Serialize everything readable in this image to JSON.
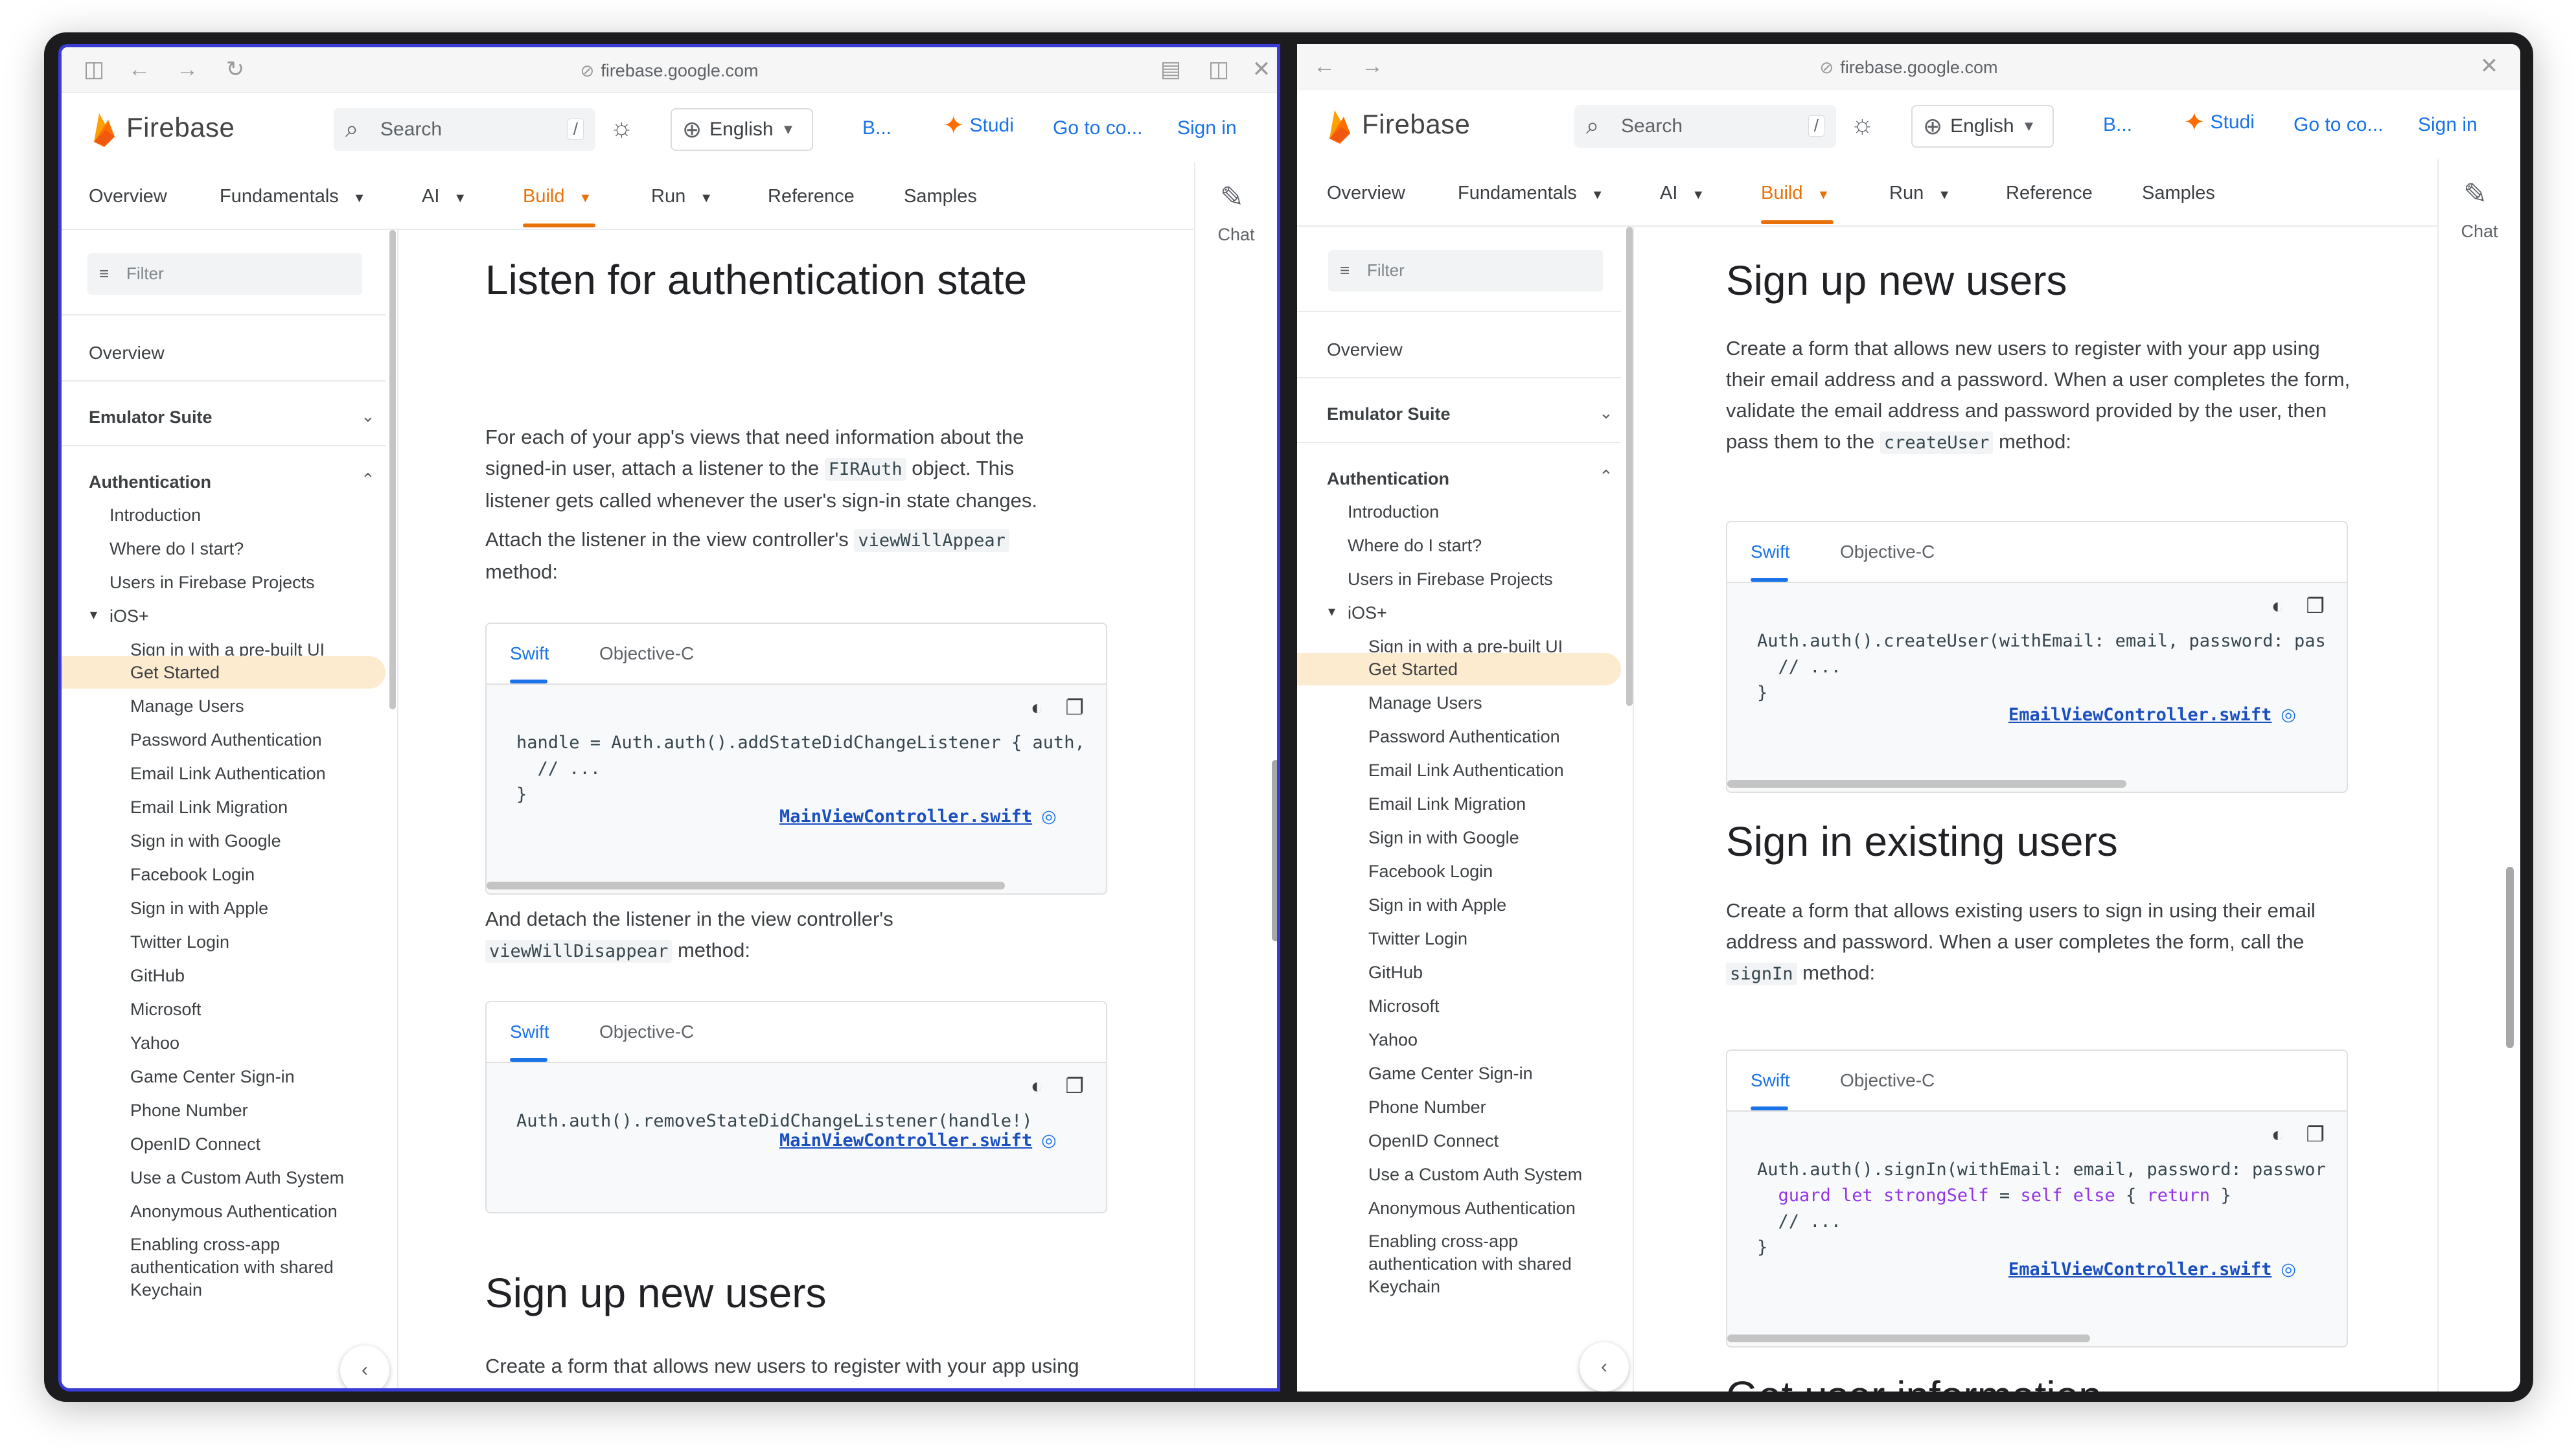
{
  "url": "firebase.google.com",
  "header": {
    "brand": "Firebase",
    "search_placeholder": "Search",
    "search_shortcut": "/",
    "language": "English",
    "link_b": "B...",
    "studio": "Studi",
    "console": "Go to co...",
    "signin": "Sign in"
  },
  "nav": {
    "tabs": [
      "Overview",
      "Fundamentals",
      "AI",
      "Build",
      "Run",
      "Reference",
      "Samples"
    ]
  },
  "chat_label": "Chat",
  "sidebar": {
    "filter": "Filter",
    "overview": "Overview",
    "emulator": "Emulator Suite",
    "authentication": "Authentication",
    "items": [
      "Introduction",
      "Where do I start?",
      "Users in Firebase Projects",
      "iOS+",
      "Sign in with a pre-built UI",
      "Get Started",
      "Manage Users",
      "Password Authentication",
      "Email Link Authentication",
      "Email Link Migration",
      "Sign in with Google",
      "Facebook Login",
      "Sign in with Apple",
      "Twitter Login",
      "GitHub",
      "Microsoft",
      "Yahoo",
      "Game Center Sign-in",
      "Phone Number",
      "OpenID Connect",
      "Use a Custom Auth System",
      "Anonymous Authentication",
      "Enabling cross-app authentication with shared Keychain"
    ]
  },
  "left": {
    "h_listen": "Listen for authentication state",
    "p1_a": "For each of your app's views that need information about the signed-in user, attach a listener to the ",
    "p1_code": "FIRAuth",
    "p1_b": " object. This listener gets called whenever the user's sign-in state changes.",
    "p2_a": "Attach the listener in the view controller's ",
    "p2_code": "viewWillAppear",
    "p2_b": " method:",
    "code1_l1": "handle = Auth.auth().addStateDidChangeListener { auth,",
    "code1_l2": "  // ...",
    "code1_l3": "}",
    "link1": "MainViewController.swift",
    "p3_a": "And detach the listener in the view controller's ",
    "p3_code": "viewWillDisappear",
    "p3_b": " method:",
    "code2_l1": "Auth.auth().removeStateDidChangeListener(handle!)",
    "link2": "MainViewController.swift",
    "h_signup": "Sign up new users",
    "p4": "Create a form that allows new users to register with your app using their email address and a password. When a user completes the form, validate the email address and password provided by the"
  },
  "right": {
    "h_signup": "Sign up new users",
    "p1_a": "Create a form that allows new users to register with your app using their email address and a password. When a user completes the form, validate the email address and password provided by the user, then pass them to the ",
    "p1_code": "createUser",
    "p1_b": " method:",
    "code1_l1": "Auth.auth().createUser(withEmail: email, password: pas",
    "code1_l2": "  // ...",
    "code1_l3": "}",
    "link1": "EmailViewController.swift",
    "h_signin": "Sign in existing users",
    "p2_a": "Create a form that allows existing users to sign in using their email address and password. When a user completes the form, call the ",
    "p2_code": "signIn",
    "p2_b": " method:",
    "code2_l1": "Auth.auth().signIn(withEmail: email, password: passwor",
    "code2_l2_a": "  ",
    "code2_l2_kw1": "guard let",
    "code2_l2_b": " ",
    "code2_l2_kw2": "strongSelf",
    "code2_l2_c": " = ",
    "code2_l2_kw3": "self else",
    "code2_l2_d": " { ",
    "code2_l2_kw4": "return",
    "code2_l2_e": " }",
    "code2_l3": "  // ...",
    "code2_l4": "}",
    "link2": "EmailViewController.swift",
    "h_getuser": "Get user information"
  },
  "code_tabs": [
    "Swift",
    "Objective-C"
  ],
  "colors": {
    "accent": "#e8710a",
    "link": "#1a73e8",
    "active_bg": "#fdebd0",
    "focus_border": "#3a3ad6"
  }
}
